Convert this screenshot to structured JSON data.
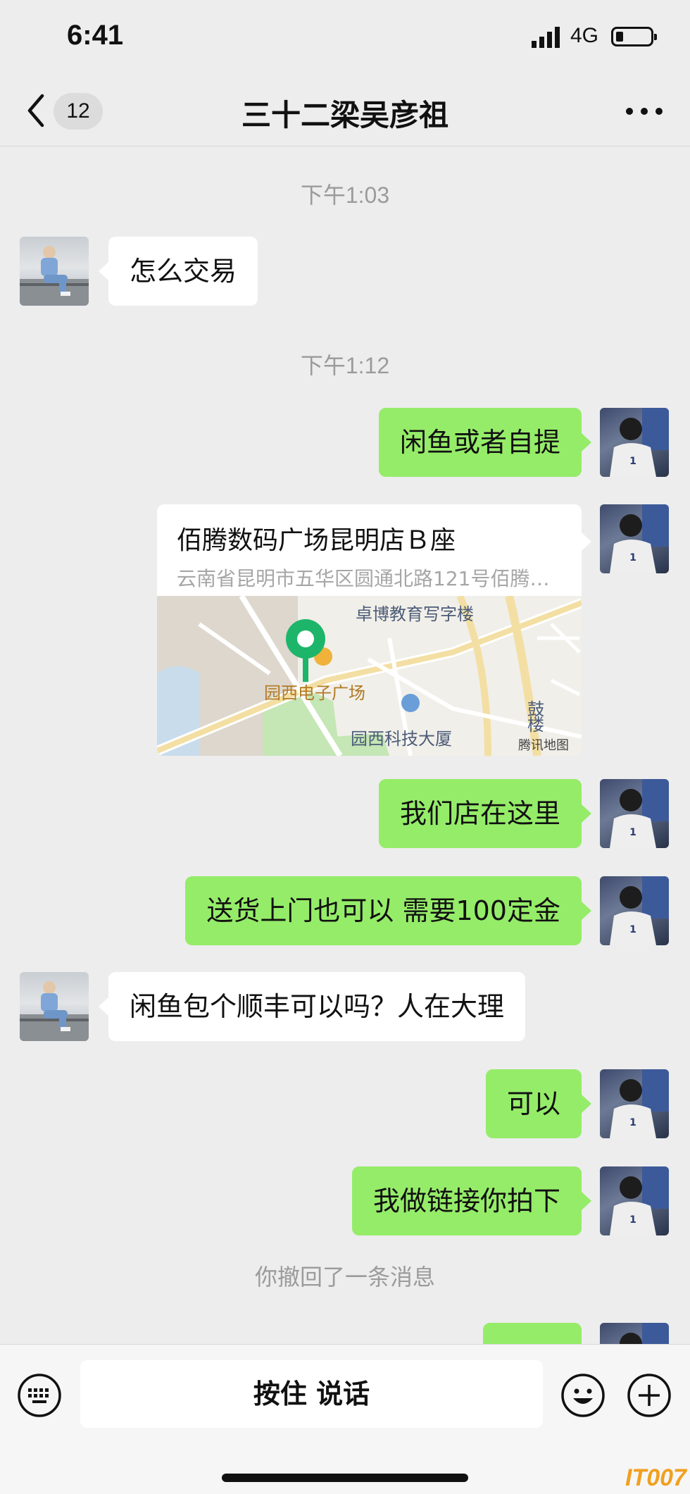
{
  "status_bar": {
    "time": "6:41",
    "network": "4G"
  },
  "nav": {
    "unread_count": "12",
    "title": "三十二梁吴彦祖"
  },
  "messages": {
    "timestamp_1": "下午1:03",
    "msg_1": "怎么交易",
    "timestamp_2": "下午1:12",
    "msg_2": "闲鱼或者自提",
    "location": {
      "title": "佰腾数码广场昆明店Ｂ座",
      "address": "云南省昆明市五华区圆通北路121号佰腾数码广场",
      "map_labels": {
        "label_1": "卓博教育写字楼",
        "label_2": "园西电子广场",
        "label_3": "园西科技大厦",
        "label_4": "鼓楼",
        "label_5": "腾讯地图"
      }
    },
    "msg_3": "我们店在这里",
    "msg_4": "送货上门也可以 需要100定金",
    "msg_5": "闲鱼包个顺丰可以吗？人在大理",
    "msg_6": "可以",
    "msg_7": "我做链接你拍下",
    "recall_notice": "你撤回了一条消息"
  },
  "input_bar": {
    "talk_label": "按住 说话"
  },
  "watermark": "IT007",
  "colors": {
    "sent_bubble": "#95ec69",
    "received_bubble": "#ffffff",
    "background": "#ededed",
    "map_pin": "#1db56a"
  },
  "icons": [
    "chevron-left-icon",
    "more-icon",
    "keyboard-icon",
    "emoji-icon",
    "plus-icon",
    "signal-icon",
    "battery-icon",
    "map-pin-icon"
  ]
}
